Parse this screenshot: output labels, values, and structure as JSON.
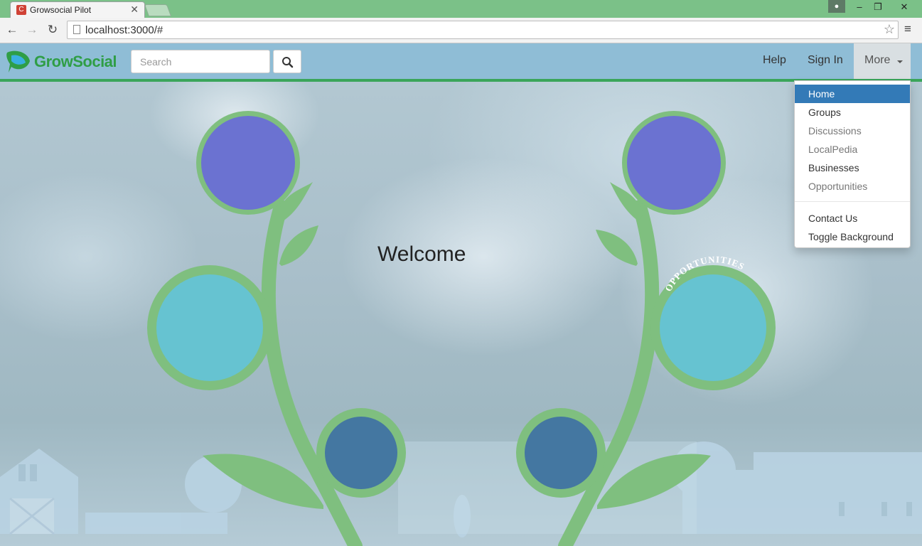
{
  "browser": {
    "tab_title": "Growsocial Pilot",
    "tab_close": "✕",
    "favicon_letter": "C",
    "url": "localhost:3000/#",
    "window_controls": {
      "minimize": "–",
      "restore": "❐",
      "close": "✕"
    }
  },
  "navbar": {
    "brand": "GrowSocial",
    "search": {
      "placeholder": "Search",
      "value": ""
    },
    "links": {
      "help": "Help",
      "sign_in": "Sign In",
      "more": "More"
    }
  },
  "dropdown": {
    "items": [
      {
        "label": "Home",
        "state": "active"
      },
      {
        "label": "Groups",
        "state": "normal"
      },
      {
        "label": "Discussions",
        "state": "muted"
      },
      {
        "label": "LocalPedia",
        "state": "muted"
      },
      {
        "label": "Businesses",
        "state": "normal"
      },
      {
        "label": "Opportunities",
        "state": "muted"
      }
    ],
    "secondary": [
      {
        "label": "Contact Us"
      },
      {
        "label": "Toggle Background"
      }
    ]
  },
  "main": {
    "welcome": "Welcome",
    "arc_label": "OPPORTUNITIES"
  },
  "colors": {
    "navbar": "#8fbdd6",
    "accent_green": "#3aa55a",
    "stem_green": "#7fbf7f",
    "circle_purple": "#6b72d1",
    "circle_cyan": "#66c3d1",
    "circle_blue": "#4477a1",
    "active_item": "#337ab7"
  }
}
